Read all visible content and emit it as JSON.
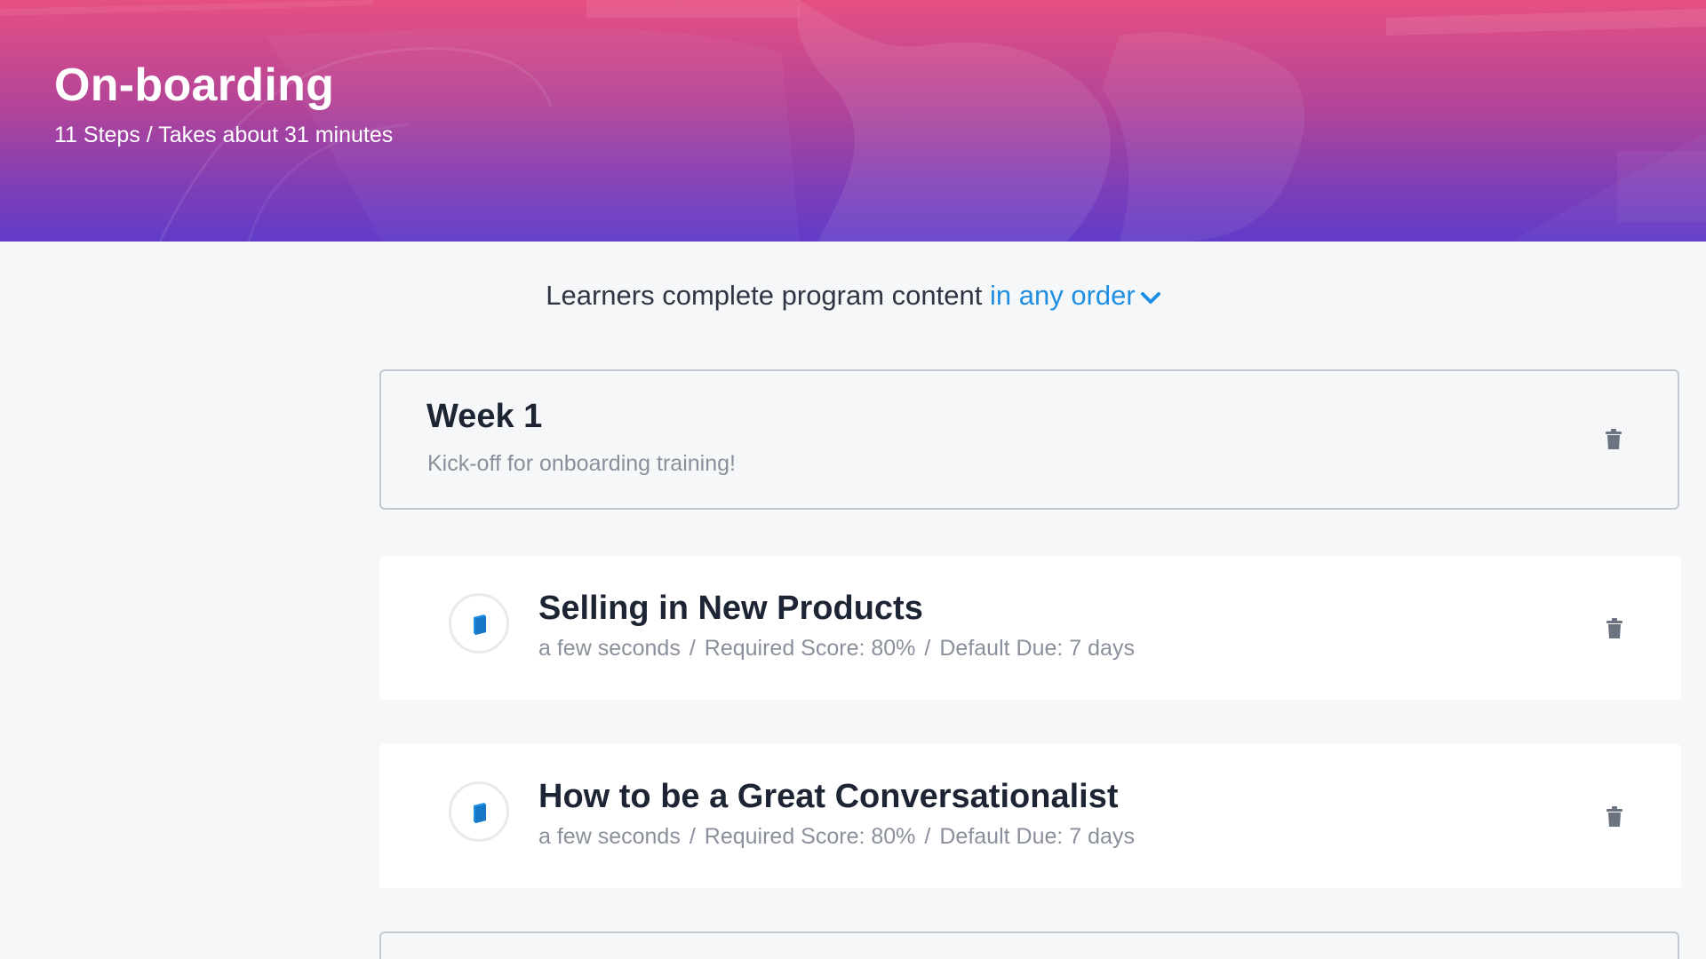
{
  "header": {
    "title": "On-boarding",
    "subtitle": "11 Steps / Takes about 31 minutes"
  },
  "order": {
    "prefix": "Learners complete program content",
    "link": "in any order",
    "chevron_icon": "chevron-down-icon"
  },
  "section": {
    "title": "Week 1",
    "description": "Kick-off for onboarding training!",
    "delete_icon": "trash-icon"
  },
  "steps": [
    {
      "title": "Selling in New Products",
      "duration": "a few seconds",
      "required_score": "Required Score: 80%",
      "default_due": "Default Due: 7 days",
      "icon": "book-icon",
      "delete_icon": "trash-icon"
    },
    {
      "title": "How to be a Great Conversationalist",
      "duration": "a few seconds",
      "required_score": "Required Score: 80%",
      "default_due": "Default Due: 7 days",
      "icon": "book-icon",
      "delete_icon": "trash-icon"
    }
  ],
  "separator": "/",
  "colors": {
    "accent": "#1f8fe3",
    "heading": "#1d2433",
    "muted": "#8a909b",
    "trash": "#6b7280"
  }
}
